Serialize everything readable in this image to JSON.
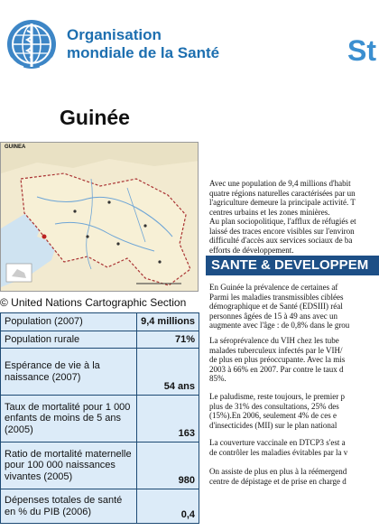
{
  "header": {
    "org_line1": "Organisation",
    "org_line2": "mondiale de la Santé",
    "title_fragment": "St"
  },
  "country": "Guinée",
  "map": {
    "corner_label": "GUINEA",
    "caption": "© United Nations Cartographic Section"
  },
  "stats": [
    {
      "label": "Population (2007)",
      "value": "9,4 millions"
    },
    {
      "label": "Population rurale",
      "value": "71%"
    },
    {
      "label": "Espérance de vie à la naissance (2007)",
      "value": "54 ans"
    },
    {
      "label": "Taux de mortalité pour 1 000 enfants de moins de 5 ans (2005)",
      "value": "163"
    },
    {
      "label": "Ratio de mortalité maternelle pour 100 000 naissances vivantes (2005)",
      "value": "980"
    },
    {
      "label": "Dépenses totales de santé en % du PIB (2006)",
      "value": "0,4"
    }
  ],
  "intro_lines": [
    "Avec une population de  9,4 millions d'habit",
    "quatre régions naturelles caractérisées par un",
    "l'agriculture demeure la principale activité. T",
    "centres urbains et les zones minières.",
    "Au plan sociopolitique, l'afflux de réfugiés et",
    "laissé des traces encore visibles sur l'environ",
    "difficulté d'accès aux services sociaux de ba",
    "efforts de développement."
  ],
  "section_heading": "SANTE & DEVELOPPEM",
  "paragraphs": [
    "En Guinée la prévalence de certaines af\nParmi les maladies transmissibles ciblées\ndémographique et de Santé (EDSIII) réal\npersonnes âgées de 15 à 49 ans avec un\naugmente avec l'âge : de 0,8% dans le grou",
    "La séroprévalence du VIH chez les tube\nmalades tuberculeux infectés par le VIH/\nde plus en plus préoccupante. Avec la mis\n2003 à 66% en 2007.  Par contre le taux d\n85%.",
    "Le paludisme, reste toujours, le premier p\nplus de 31% des consultations, 25% des\n(15%).En 2006, seulement 4% de ces e\nd'insecticides (MII) sur le plan national",
    "La couverture vaccinale en DTCP3 s'est a\nde contrôler les maladies évitables par la v",
    "On assiste de plus en plus à la réémergend\ncentre de dépistage et de prise en charge d"
  ]
}
